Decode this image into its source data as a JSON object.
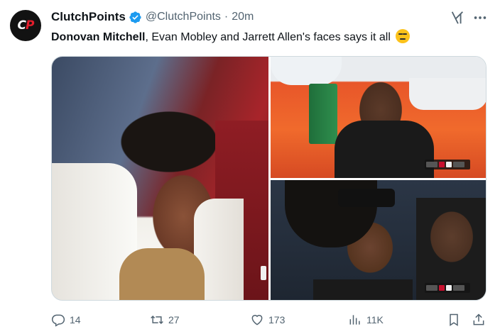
{
  "tweet": {
    "author_name": "ClutchPoints",
    "handle": "@ClutchPoints",
    "separator": "·",
    "time": "20m",
    "avatar_logo_left": "C",
    "avatar_logo_right": "P",
    "text_bold": "Donovan Mitchell",
    "text_rest": ", Evan Mobley and Jarrett Allen's faces says it all",
    "emoji_name": "expressionless-face-emoji"
  },
  "icons": {
    "verified": "verified-badge-icon",
    "grok": "grok-icon",
    "more": "more-icon",
    "reply": "reply-icon",
    "retweet": "retweet-icon",
    "like": "like-icon",
    "views": "views-icon",
    "bookmark": "bookmark-icon",
    "share": "share-icon"
  },
  "colors": {
    "verified": "#1d9bf0",
    "secondary_text": "#536471",
    "brand_red": "#e21d2b"
  },
  "actions": {
    "replies": "14",
    "retweets": "27",
    "likes": "173",
    "views": "11K"
  }
}
